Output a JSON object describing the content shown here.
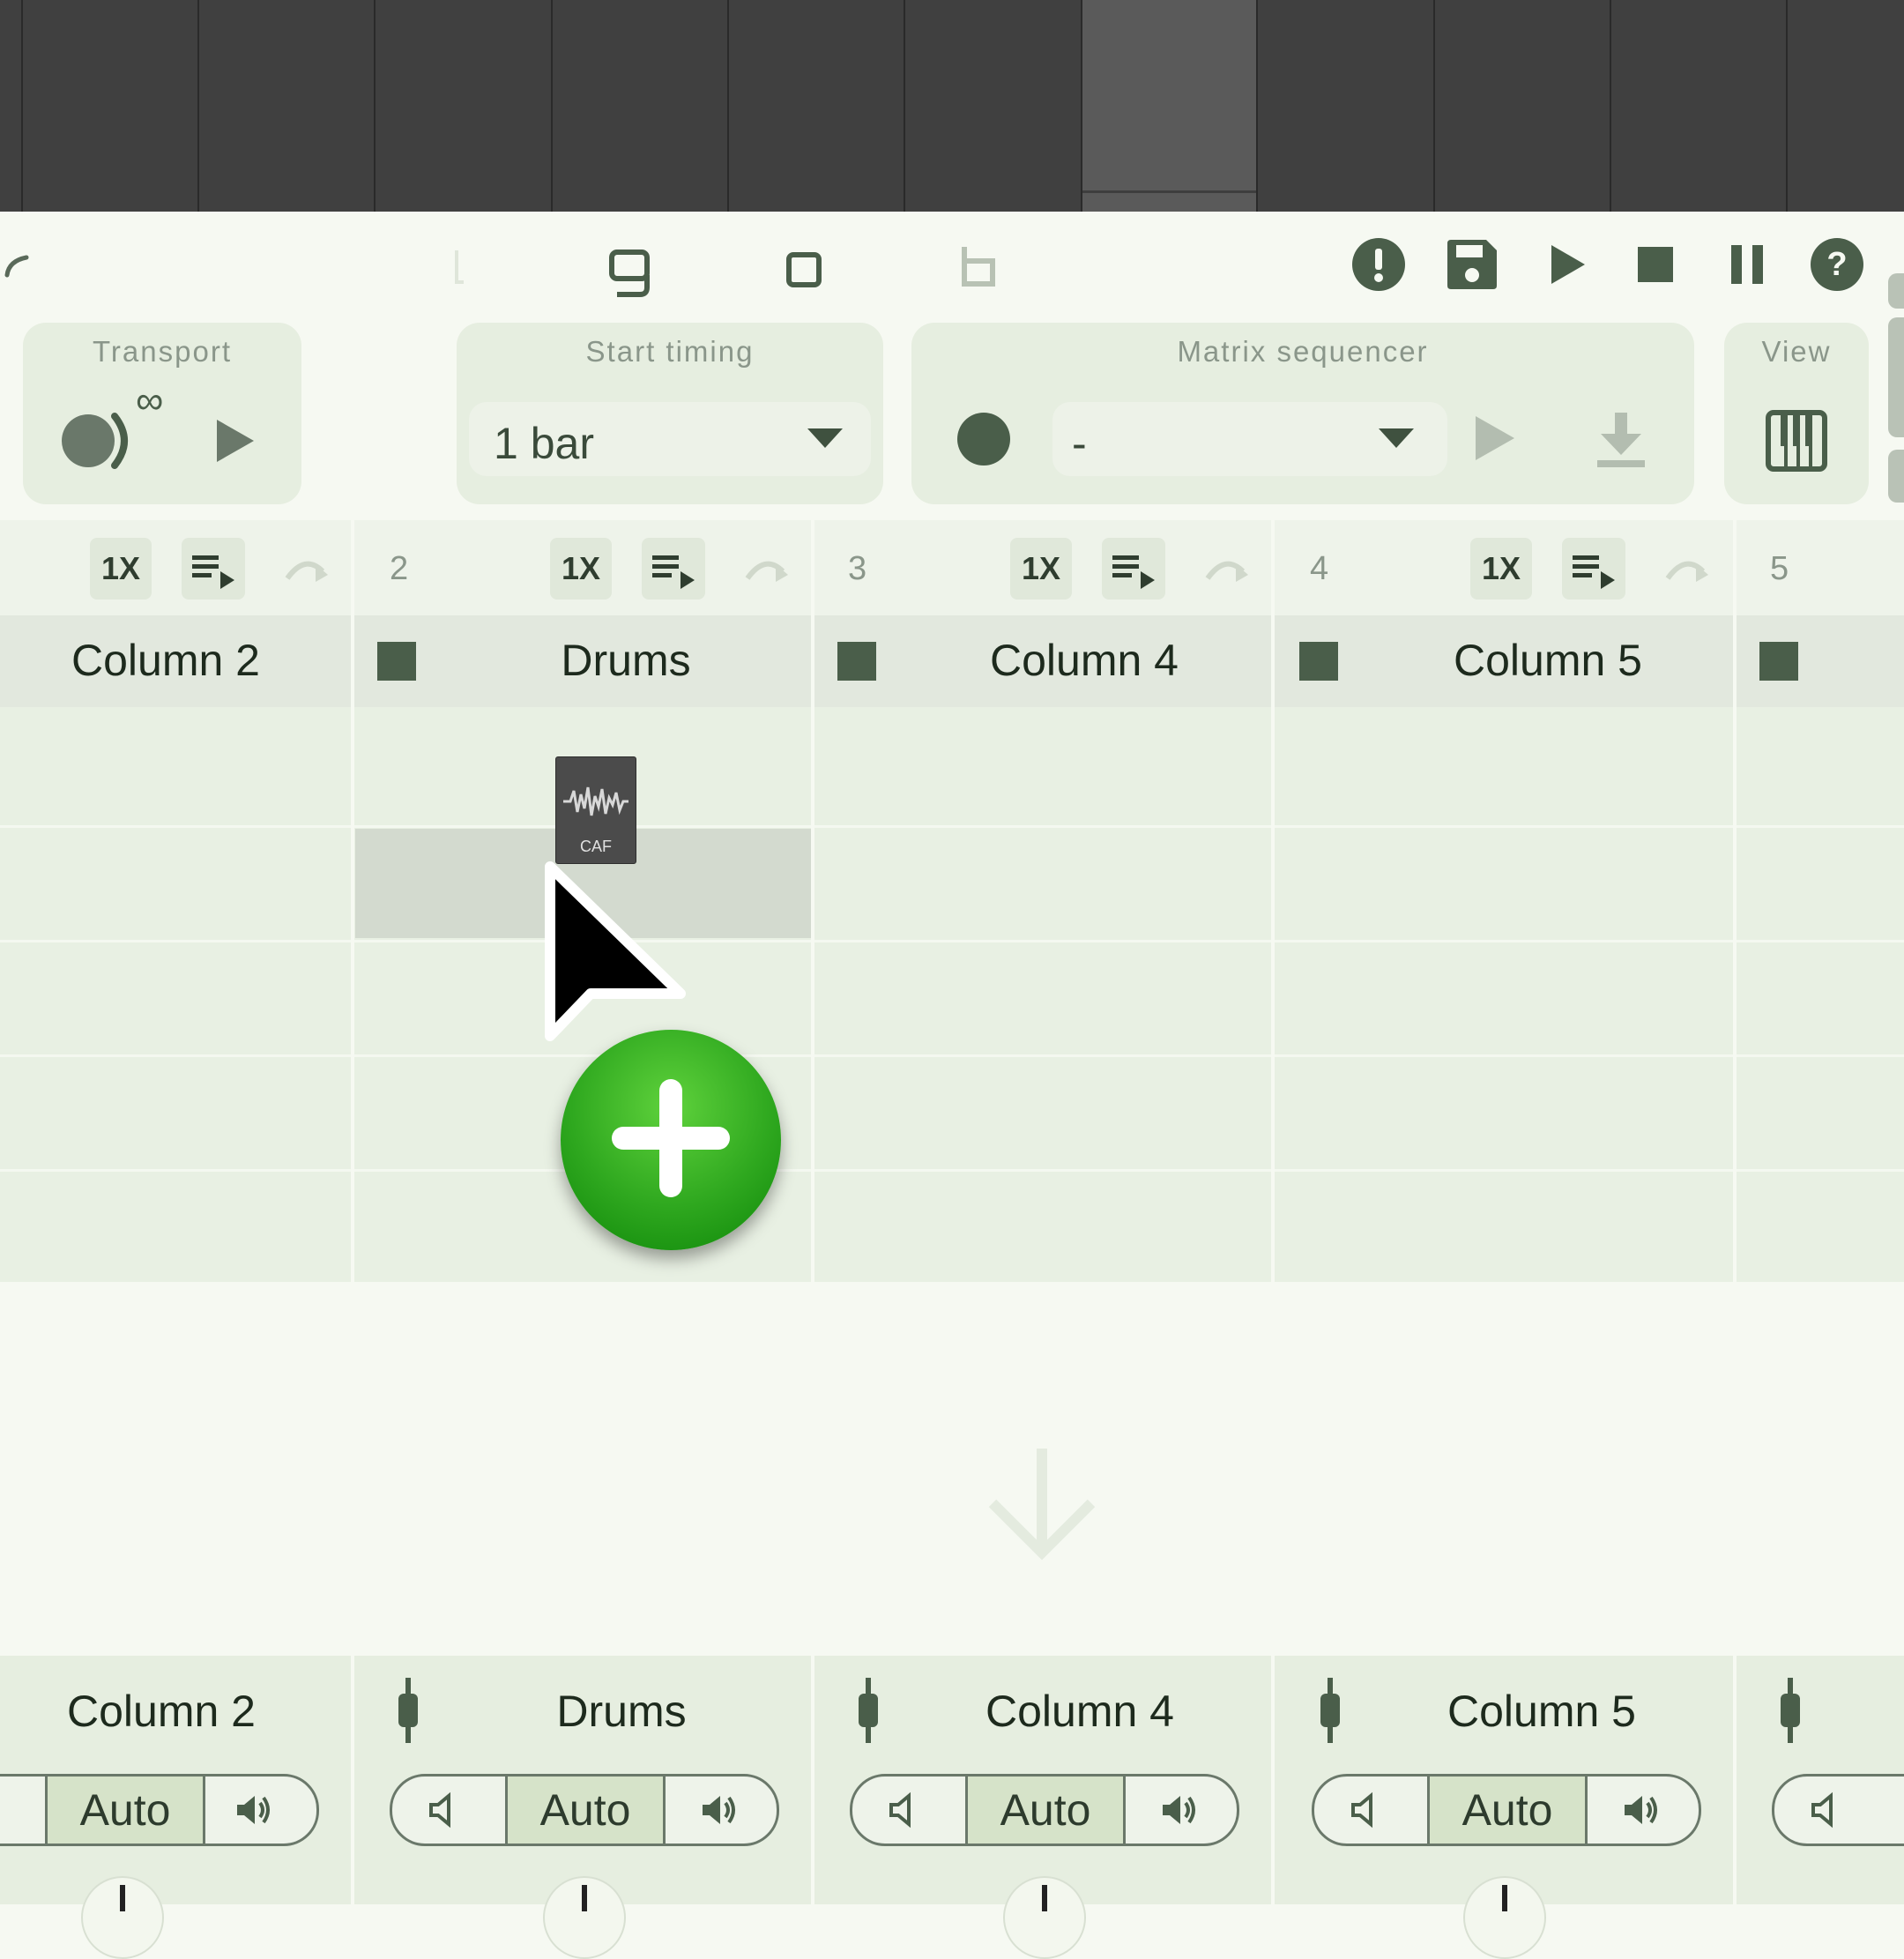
{
  "panels": {
    "transport": {
      "title": "Transport",
      "loop_symbol": "∞"
    },
    "start_timing": {
      "title": "Start timing",
      "value": "1 bar"
    },
    "matrix_sequencer": {
      "title": "Matrix sequencer",
      "value": "-"
    },
    "view": {
      "title": "View"
    }
  },
  "toolbar_icons": [
    "alert-icon",
    "save-icon",
    "play-icon",
    "stop-icon",
    "pause-icon",
    "help-icon"
  ],
  "columns": [
    {
      "name": "Column 2",
      "number": "2"
    },
    {
      "name": "Drums",
      "number": "3"
    },
    {
      "name": "Column 4",
      "number": "4"
    },
    {
      "name": "Column 5",
      "number": "5"
    }
  ],
  "column_controls": {
    "repeat_label": "1X"
  },
  "drag_file": {
    "label": "CAF"
  },
  "mixer": {
    "channels": [
      {
        "name": "Column 2",
        "mode": "Auto"
      },
      {
        "name": "Drums",
        "mode": "Auto"
      },
      {
        "name": "Column 4",
        "mode": "Auto"
      },
      {
        "name": "Column 5",
        "mode": "Auto"
      }
    ]
  },
  "colors": {
    "accent": "#4a5e4a",
    "background": "#f6f9f2",
    "plus_badge": "#2fa81f"
  }
}
